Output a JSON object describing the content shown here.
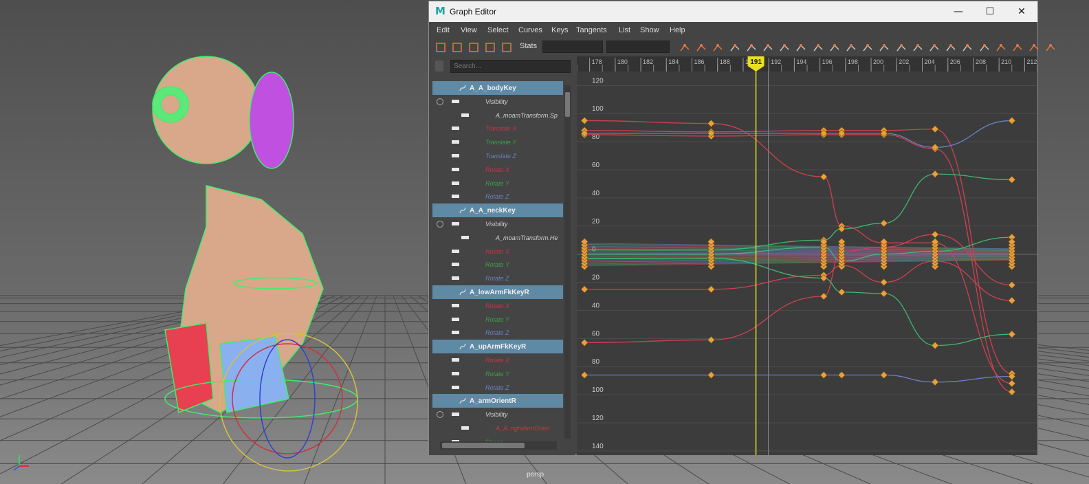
{
  "viewport": {
    "camera_label": "persp",
    "axis_labels": [
      "y",
      "x"
    ]
  },
  "window": {
    "title": "Graph Editor",
    "minimize": "—",
    "maximize": "☐",
    "close": "✕"
  },
  "menubar": [
    "Edit",
    "View",
    "Select",
    "Curves",
    "Keys",
    "Tangents",
    "List",
    "Show",
    "Help"
  ],
  "toolbar": {
    "stats_label": "Stats",
    "stats_value_1": "",
    "stats_value_2": "",
    "left_icons": [
      "move-key-icon",
      "insert-key-icon",
      "lattice-icon",
      "region-select-icon",
      "retime-icon"
    ],
    "right_icons": [
      "frame-all-icon",
      "frame-selection-icon",
      "center-current-icon",
      "auto-tangent-icon",
      "spline-tangent-icon",
      "clamped-tangent-icon",
      "linear-tangent-icon",
      "flat-tangent-icon",
      "step-tangent-icon",
      "plateau-tangent-icon",
      "break-tangent-icon",
      "unify-tangent-icon",
      "free-weight-icon",
      "lock-weight-icon",
      "normalize-icon",
      "denormalize-icon",
      "pre-infinity-icon",
      "post-infinity-icon",
      "buffer-curve-icon",
      "swap-buffer-icon",
      "dope-sheet-icon",
      "trax-icon",
      "time-editor-icon"
    ]
  },
  "outliner": {
    "search_placeholder": "Search...",
    "rows": [
      {
        "kind": "header",
        "label": "A_A_bodyKey"
      },
      {
        "kind": "channel",
        "label": "Visibility",
        "color": "#cfcfcf",
        "indent": 1,
        "expand": true
      },
      {
        "kind": "channel",
        "label": "A_moamTransform.Sp",
        "color": "#cfcfcf",
        "indent": 2
      },
      {
        "kind": "channel",
        "label": "Translate X",
        "color": "#c8324a",
        "indent": 1
      },
      {
        "kind": "channel",
        "label": "Translate Y",
        "color": "#3aa04a",
        "indent": 1
      },
      {
        "kind": "channel",
        "label": "Translate Z",
        "color": "#6a7fc0",
        "indent": 1
      },
      {
        "kind": "channel",
        "label": "Rotate X",
        "color": "#c8324a",
        "indent": 1
      },
      {
        "kind": "channel",
        "label": "Rotate Y",
        "color": "#3aa04a",
        "indent": 1
      },
      {
        "kind": "channel",
        "label": "Rotate Z",
        "color": "#6a7fc0",
        "indent": 1
      },
      {
        "kind": "header",
        "label": "A_A_neckKey"
      },
      {
        "kind": "channel",
        "label": "Visibility",
        "color": "#cfcfcf",
        "indent": 1,
        "expand": true
      },
      {
        "kind": "channel",
        "label": "A_moamTransform.He",
        "color": "#cfcfcf",
        "indent": 2
      },
      {
        "kind": "channel",
        "label": "Rotate X",
        "color": "#c8324a",
        "indent": 1
      },
      {
        "kind": "channel",
        "label": "Rotate Y",
        "color": "#3aa04a",
        "indent": 1
      },
      {
        "kind": "channel",
        "label": "Rotate Z",
        "color": "#6a7fc0",
        "indent": 1
      },
      {
        "kind": "header",
        "label": "A_lowArmFkKeyR"
      },
      {
        "kind": "channel",
        "label": "Rotate X",
        "color": "#c8324a",
        "indent": 1
      },
      {
        "kind": "channel",
        "label": "Rotate Y",
        "color": "#3aa04a",
        "indent": 1
      },
      {
        "kind": "channel",
        "label": "Rotate Z",
        "color": "#6a7fc0",
        "indent": 1
      },
      {
        "kind": "header",
        "label": "A_upArmFkKeyR"
      },
      {
        "kind": "channel",
        "label": "Rotate X",
        "color": "#c8324a",
        "indent": 1
      },
      {
        "kind": "channel",
        "label": "Rotate Y",
        "color": "#3aa04a",
        "indent": 1
      },
      {
        "kind": "channel",
        "label": "Rotate Z",
        "color": "#6a7fc0",
        "indent": 1
      },
      {
        "kind": "header",
        "label": "A_armOrientR"
      },
      {
        "kind": "channel",
        "label": "Visibility",
        "color": "#cfcfcf",
        "indent": 1,
        "expand": true
      },
      {
        "kind": "channel",
        "label": "A_A_rightArmOrien",
        "color": "#e03030",
        "indent": 2
      },
      {
        "kind": "channel",
        "label": "Space",
        "color": "#3aa04a",
        "indent": 1
      }
    ]
  },
  "graph": {
    "current_frame": "191",
    "frame_ticks": [
      "178",
      "180",
      "182",
      "184",
      "186",
      "188",
      "190",
      "191",
      "192",
      "194",
      "196",
      "198",
      "200",
      "202",
      "204",
      "206",
      "208",
      "210",
      "212"
    ],
    "value_labels": [
      "120",
      "100",
      "80",
      "60",
      "40",
      "20",
      "0",
      "20",
      "40",
      "60",
      "80",
      "100",
      "120",
      "140"
    ],
    "colors": {
      "red": "#d04050",
      "green": "#40b870",
      "blue": "#6a80c8",
      "key": "#e8a040",
      "time": "#e8e020"
    }
  },
  "chart_data": {
    "type": "line",
    "x_range": [
      177,
      213
    ],
    "y_range": [
      -143,
      128
    ],
    "key_frames": [
      177.6,
      187.5,
      196.3,
      197.7,
      201,
      205,
      211
    ],
    "series": [
      {
        "color": "red",
        "keys": [
          [
            177.6,
            95
          ],
          [
            187.5,
            93
          ],
          [
            196.3,
            55
          ],
          [
            197.7,
            20
          ],
          [
            201,
            8
          ],
          [
            205,
            8
          ],
          [
            211,
            -92
          ]
        ]
      },
      {
        "color": "red",
        "keys": [
          [
            177.6,
            88
          ],
          [
            187.5,
            87
          ],
          [
            196.3,
            88
          ],
          [
            197.7,
            88
          ],
          [
            201,
            88
          ],
          [
            205,
            89
          ],
          [
            211,
            -85
          ]
        ]
      },
      {
        "color": "red",
        "keys": [
          [
            177.6,
            85
          ],
          [
            187.5,
            84
          ],
          [
            196.3,
            85
          ],
          [
            197.7,
            85
          ],
          [
            201,
            85
          ],
          [
            205,
            75
          ],
          [
            211,
            -98
          ]
        ]
      },
      {
        "color": "blue",
        "keys": [
          [
            177.6,
            86
          ],
          [
            187.5,
            86
          ],
          [
            196.3,
            86
          ],
          [
            197.7,
            86
          ],
          [
            201,
            86
          ],
          [
            205,
            76
          ],
          [
            211,
            95
          ]
        ]
      },
      {
        "color": "red",
        "keys": [
          [
            177.6,
            -25
          ],
          [
            187.5,
            -25
          ],
          [
            196.3,
            -15
          ],
          [
            197.7,
            -8
          ],
          [
            201,
            -20
          ],
          [
            205,
            -5
          ],
          [
            211,
            -33
          ]
        ]
      },
      {
        "color": "red",
        "keys": [
          [
            177.6,
            -63
          ],
          [
            187.5,
            -61
          ],
          [
            196.3,
            -30
          ],
          [
            197.7,
            2
          ],
          [
            201,
            5
          ],
          [
            205,
            14
          ],
          [
            211,
            -22
          ]
        ]
      },
      {
        "color": "blue",
        "keys": [
          [
            177.6,
            -86
          ],
          [
            187.5,
            -86
          ],
          [
            196.3,
            -86
          ],
          [
            197.7,
            -86
          ],
          [
            201,
            -86
          ],
          [
            205,
            -91
          ],
          [
            211,
            -87
          ]
        ]
      },
      {
        "color": "green",
        "keys": [
          [
            177.6,
            3
          ],
          [
            187.5,
            3
          ],
          [
            196.3,
            10
          ],
          [
            197.7,
            18
          ],
          [
            201,
            22
          ],
          [
            205,
            57
          ],
          [
            211,
            53
          ]
        ]
      },
      {
        "color": "green",
        "keys": [
          [
            177.6,
            -3
          ],
          [
            187.5,
            -3
          ],
          [
            196.3,
            -17
          ],
          [
            197.7,
            -27
          ],
          [
            201,
            -28
          ],
          [
            205,
            -65
          ],
          [
            211,
            -57
          ]
        ]
      },
      {
        "color": "green",
        "keys": [
          [
            177.6,
            0
          ],
          [
            187.5,
            0
          ],
          [
            196.3,
            5
          ],
          [
            197.7,
            -5
          ],
          [
            201,
            0
          ],
          [
            205,
            2
          ],
          [
            211,
            12
          ]
        ]
      }
    ]
  }
}
